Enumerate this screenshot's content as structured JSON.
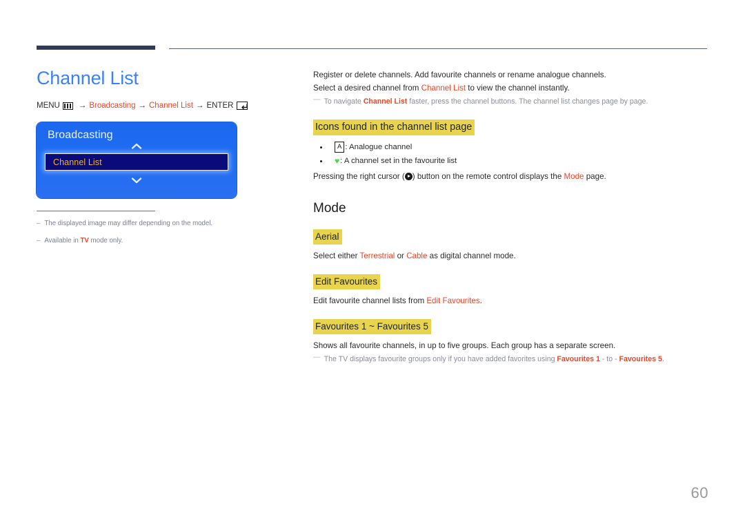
{
  "header": {
    "bar_color": "#333a56",
    "line_color": "#5b5f7e"
  },
  "left": {
    "page_title": "Channel List",
    "menu_path": {
      "menu_label": "MENU",
      "menu_icon": "menu-grid-icon",
      "arrow1": "→",
      "item1": "Broadcasting",
      "arrow2": "→",
      "item2": "Channel List",
      "arrow3": "→",
      "enter_label": "ENTER",
      "enter_icon": "enter-key-icon"
    },
    "osd": {
      "title": "Broadcasting",
      "chevron_up": "chevron-up-icon",
      "chevron_down": "chevron-down-icon",
      "selected_item": "Channel List",
      "bg_color": "#1f6cf2",
      "selected_bg": "#0a0a7a",
      "selected_text_color": "#f0b429"
    },
    "footnotes": [
      {
        "dash": "–",
        "text_before": "The displayed image may differ depending on the model.",
        "highlight": "",
        "text_after": ""
      },
      {
        "dash": "–",
        "text_before": "Available in ",
        "highlight": "TV",
        "text_after": " mode only."
      }
    ]
  },
  "right": {
    "intro": {
      "line1": "Register or delete channels. Add favourite channels or rename analogue channels.",
      "line2_a": "Select a desired channel from ",
      "line2_link": "Channel List",
      "line2_b": " to view the channel instantly.",
      "note_a": "To navigate ",
      "note_link": "Channel List",
      "note_b": " faster, press the channel buttons. The channel list changes page by page."
    },
    "icons_section": {
      "heading": "Icons found in the channel list page",
      "bullets": [
        {
          "icon": "A",
          "icon_type": "boxed-letter",
          "text": ": Analogue channel"
        },
        {
          "icon": "♥",
          "icon_type": "heart",
          "text": ": A channel set in the favourite list"
        }
      ],
      "trailer_a": "Pressing the right cursor (",
      "trailer_icon": "right-cursor-icon",
      "trailer_b": ") button on the remote control displays the ",
      "trailer_link": "Mode",
      "trailer_c": " page."
    },
    "mode_section": {
      "heading": "Mode",
      "aerial": {
        "heading": "Aerial",
        "body_a": "Select either ",
        "link1": "Terrestrial",
        "body_b": " or ",
        "link2": "Cable",
        "body_c": " as digital channel mode."
      },
      "edit_favourites": {
        "heading": "Edit Favourites",
        "body_a": "Edit favourite channel lists from ",
        "link1": "Edit Favourites",
        "body_b": "."
      },
      "favourites_range": {
        "heading": "Favourites 1 ~ Favourites 5",
        "body": "Shows all favourite channels, in up to five groups. Each group has a separate screen.",
        "note_a": "The TV displays favourite groups only if you have added favorites using ",
        "note_link1": "Favourites 1",
        "note_b": " - to - ",
        "note_link2": "Favourites 5",
        "note_c": "."
      }
    }
  },
  "footer": {
    "page_number": "60"
  },
  "colors": {
    "accent_blue": "#3b82f6",
    "accent_red": "#e8472a",
    "highlight_yellow": "#e8d44d",
    "osd_blue": "#1f6cf2",
    "note_gray": "#8b8e9c"
  }
}
